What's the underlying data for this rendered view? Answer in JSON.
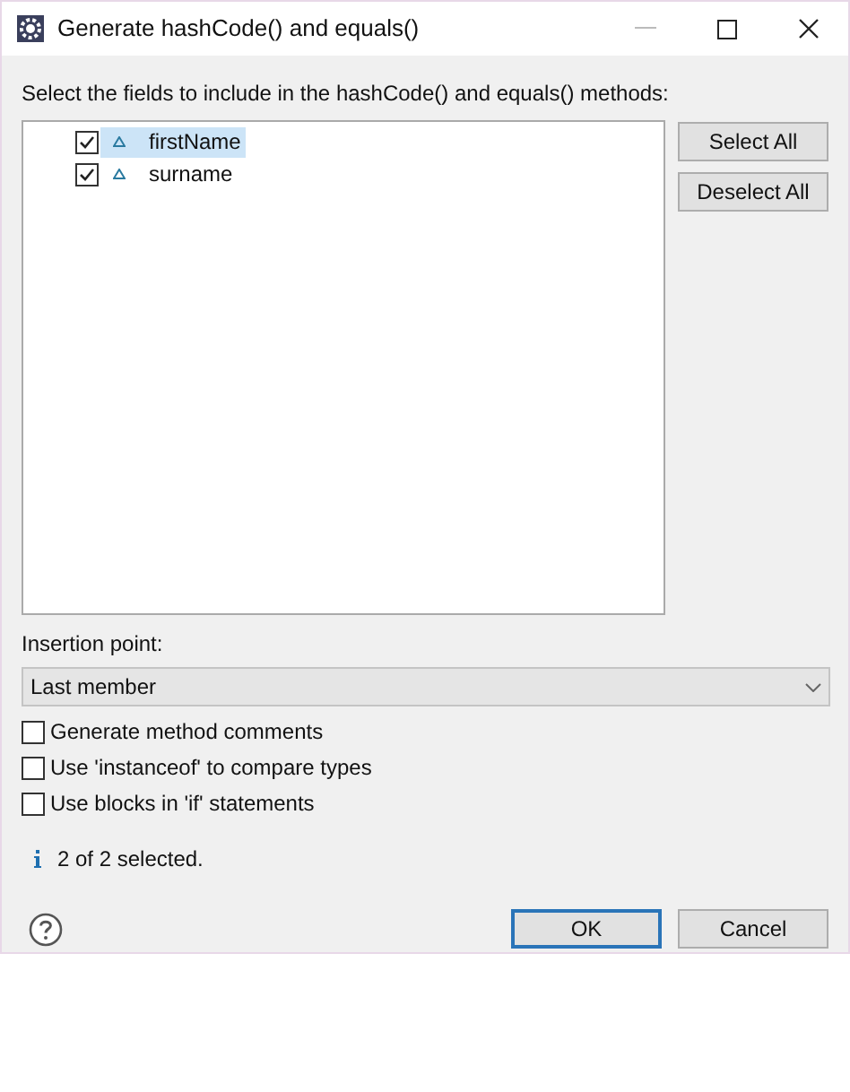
{
  "window": {
    "title": "Generate hashCode() and equals()"
  },
  "prompt": "Select the fields to include in the hashCode() and equals() methods:",
  "fields": [
    {
      "name": "firstName",
      "checked": true,
      "selected": true
    },
    {
      "name": "surname",
      "checked": true,
      "selected": false
    }
  ],
  "side_buttons": [
    "Select All",
    "Deselect All"
  ],
  "insertion_point": {
    "label": "Insertion point:",
    "value": "Last member"
  },
  "options": [
    {
      "label": "Generate method comments",
      "checked": false
    },
    {
      "label": "Use 'instanceof' to compare types",
      "checked": false
    },
    {
      "label": "Use blocks in 'if' statements",
      "checked": false
    }
  ],
  "status": "2 of 2 selected.",
  "buttons": [
    {
      "label": "OK",
      "default": true
    },
    {
      "label": "Cancel",
      "default": false
    }
  ]
}
